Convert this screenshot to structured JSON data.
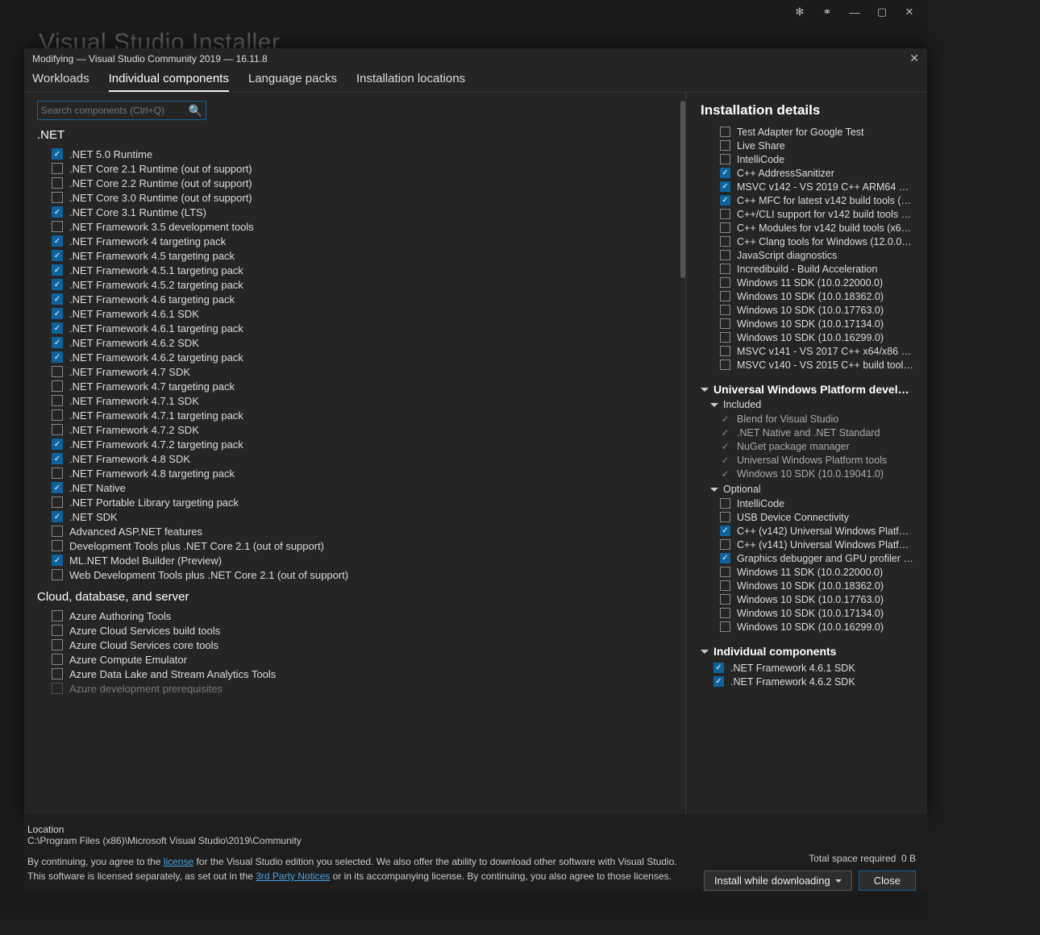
{
  "outer": {
    "bg_title": "Visual Studio Installer",
    "sys_icons": {
      "settings": "✻",
      "people": "⚭",
      "min": "—",
      "max": "▢",
      "close": "✕"
    }
  },
  "modal": {
    "title": "Modifying — Visual Studio Community 2019 — 16.11.8",
    "close": "✕",
    "tabs": [
      {
        "label": "Workloads",
        "active": false
      },
      {
        "label": "Individual components",
        "active": true
      },
      {
        "label": "Language packs",
        "active": false
      },
      {
        "label": "Installation locations",
        "active": false
      }
    ]
  },
  "search": {
    "placeholder": "Search components (Ctrl+Q)"
  },
  "categories": [
    {
      "name": ".NET",
      "items": [
        {
          "label": ".NET 5.0 Runtime",
          "checked": true
        },
        {
          "label": ".NET Core 2.1 Runtime (out of support)",
          "checked": false
        },
        {
          "label": ".NET Core 2.2 Runtime (out of support)",
          "checked": false
        },
        {
          "label": ".NET Core 3.0 Runtime (out of support)",
          "checked": false
        },
        {
          "label": ".NET Core 3.1 Runtime (LTS)",
          "checked": true
        },
        {
          "label": ".NET Framework 3.5 development tools",
          "checked": false
        },
        {
          "label": ".NET Framework 4 targeting pack",
          "checked": true
        },
        {
          "label": ".NET Framework 4.5 targeting pack",
          "checked": true
        },
        {
          "label": ".NET Framework 4.5.1 targeting pack",
          "checked": true
        },
        {
          "label": ".NET Framework 4.5.2 targeting pack",
          "checked": true
        },
        {
          "label": ".NET Framework 4.6 targeting pack",
          "checked": true
        },
        {
          "label": ".NET Framework 4.6.1 SDK",
          "checked": true
        },
        {
          "label": ".NET Framework 4.6.1 targeting pack",
          "checked": true
        },
        {
          "label": ".NET Framework 4.6.2 SDK",
          "checked": true
        },
        {
          "label": ".NET Framework 4.6.2 targeting pack",
          "checked": true
        },
        {
          "label": ".NET Framework 4.7 SDK",
          "checked": false
        },
        {
          "label": ".NET Framework 4.7 targeting pack",
          "checked": false
        },
        {
          "label": ".NET Framework 4.7.1 SDK",
          "checked": false
        },
        {
          "label": ".NET Framework 4.7.1 targeting pack",
          "checked": false
        },
        {
          "label": ".NET Framework 4.7.2 SDK",
          "checked": false
        },
        {
          "label": ".NET Framework 4.7.2 targeting pack",
          "checked": true
        },
        {
          "label": ".NET Framework 4.8 SDK",
          "checked": true
        },
        {
          "label": ".NET Framework 4.8 targeting pack",
          "checked": false
        },
        {
          "label": ".NET Native",
          "checked": true
        },
        {
          "label": ".NET Portable Library targeting pack",
          "checked": false
        },
        {
          "label": ".NET SDK",
          "checked": true
        },
        {
          "label": "Advanced ASP.NET features",
          "checked": false
        },
        {
          "label": "Development Tools plus .NET Core 2.1 (out of support)",
          "checked": false
        },
        {
          "label": "ML.NET Model Builder (Preview)",
          "checked": true
        },
        {
          "label": "Web Development Tools plus .NET Core 2.1 (out of support)",
          "checked": false
        }
      ]
    },
    {
      "name": "Cloud, database, and server",
      "items": [
        {
          "label": "Azure Authoring Tools",
          "checked": false
        },
        {
          "label": "Azure Cloud Services build tools",
          "checked": false
        },
        {
          "label": "Azure Cloud Services core tools",
          "checked": false
        },
        {
          "label": "Azure Compute Emulator",
          "checked": false
        },
        {
          "label": "Azure Data Lake and Stream Analytics Tools",
          "checked": false
        },
        {
          "label": "Azure development prerequisites",
          "checked": false,
          "dim": true
        }
      ]
    }
  ],
  "details": {
    "title": "Installation details",
    "top_items": [
      {
        "label": "Test Adapter for Google Test",
        "checked": false
      },
      {
        "label": "Live Share",
        "checked": false
      },
      {
        "label": "IntelliCode",
        "checked": false
      },
      {
        "label": "C++ AddressSanitizer",
        "checked": true
      },
      {
        "label": "MSVC v142 - VS 2019 C++ ARM64 build t...",
        "checked": true
      },
      {
        "label": "C++ MFC for latest v142 build tools (x86...",
        "checked": true
      },
      {
        "label": "C++/CLI support for v142 build tools (Late...",
        "checked": false
      },
      {
        "label": "C++ Modules for v142 build tools (x64/x8...",
        "checked": false
      },
      {
        "label": "C++ Clang tools for Windows (12.0.0 - x64...",
        "checked": false
      },
      {
        "label": "JavaScript diagnostics",
        "checked": false
      },
      {
        "label": "Incredibuild - Build Acceleration",
        "checked": false
      },
      {
        "label": "Windows 11 SDK (10.0.22000.0)",
        "checked": false
      },
      {
        "label": "Windows 10 SDK (10.0.18362.0)",
        "checked": false
      },
      {
        "label": "Windows 10 SDK (10.0.17763.0)",
        "checked": false
      },
      {
        "label": "Windows 10 SDK (10.0.17134.0)",
        "checked": false
      },
      {
        "label": "Windows 10 SDK (10.0.16299.0)",
        "checked": false
      },
      {
        "label": "MSVC v141 - VS 2017 C++ x64/x86 build t...",
        "checked": false
      },
      {
        "label": "MSVC v140 - VS 2015 C++ build tools (v1...",
        "checked": false
      }
    ],
    "uwp": {
      "title": "Universal Windows Platform develop...",
      "included_label": "Included",
      "included": [
        "Blend for Visual Studio",
        ".NET Native and .NET Standard",
        "NuGet package manager",
        "Universal Windows Platform tools",
        "Windows 10 SDK (10.0.19041.0)"
      ],
      "optional_label": "Optional",
      "optional": [
        {
          "label": "IntelliCode",
          "checked": false
        },
        {
          "label": "USB Device Connectivity",
          "checked": false
        },
        {
          "label": "C++ (v142) Universal Windows Platform to...",
          "checked": true
        },
        {
          "label": "C++ (v141) Universal Windows Platform to...",
          "checked": false
        },
        {
          "label": "Graphics debugger and GPU profiler for Di...",
          "checked": true
        },
        {
          "label": "Windows 11 SDK (10.0.22000.0)",
          "checked": false
        },
        {
          "label": "Windows 10 SDK (10.0.18362.0)",
          "checked": false
        },
        {
          "label": "Windows 10 SDK (10.0.17763.0)",
          "checked": false
        },
        {
          "label": "Windows 10 SDK (10.0.17134.0)",
          "checked": false
        },
        {
          "label": "Windows 10 SDK (10.0.16299.0)",
          "checked": false
        }
      ]
    },
    "individual": {
      "title": "Individual components",
      "items": [
        {
          "label": ".NET Framework 4.6.1 SDK",
          "checked": true
        },
        {
          "label": ".NET Framework 4.6.2 SDK",
          "checked": true
        }
      ]
    }
  },
  "footer": {
    "loc_label": "Location",
    "loc": "C:\\Program Files (x86)\\Microsoft Visual Studio\\2019\\Community",
    "text1_pre": "By continuing, you agree to the ",
    "license": "license",
    "text1_mid": " for the Visual Studio edition you selected. We also offer the ability to download other software with Visual Studio.",
    "text2_pre": "This software is licensed separately, as set out in the ",
    "notices": "3rd Party Notices",
    "text2_post": " or in its accompanying license. By continuing, you also agree to those licenses.",
    "space_label": "Total space required",
    "space_val": "0 B",
    "install_btn": "Install while downloading",
    "close_btn": "Close"
  }
}
